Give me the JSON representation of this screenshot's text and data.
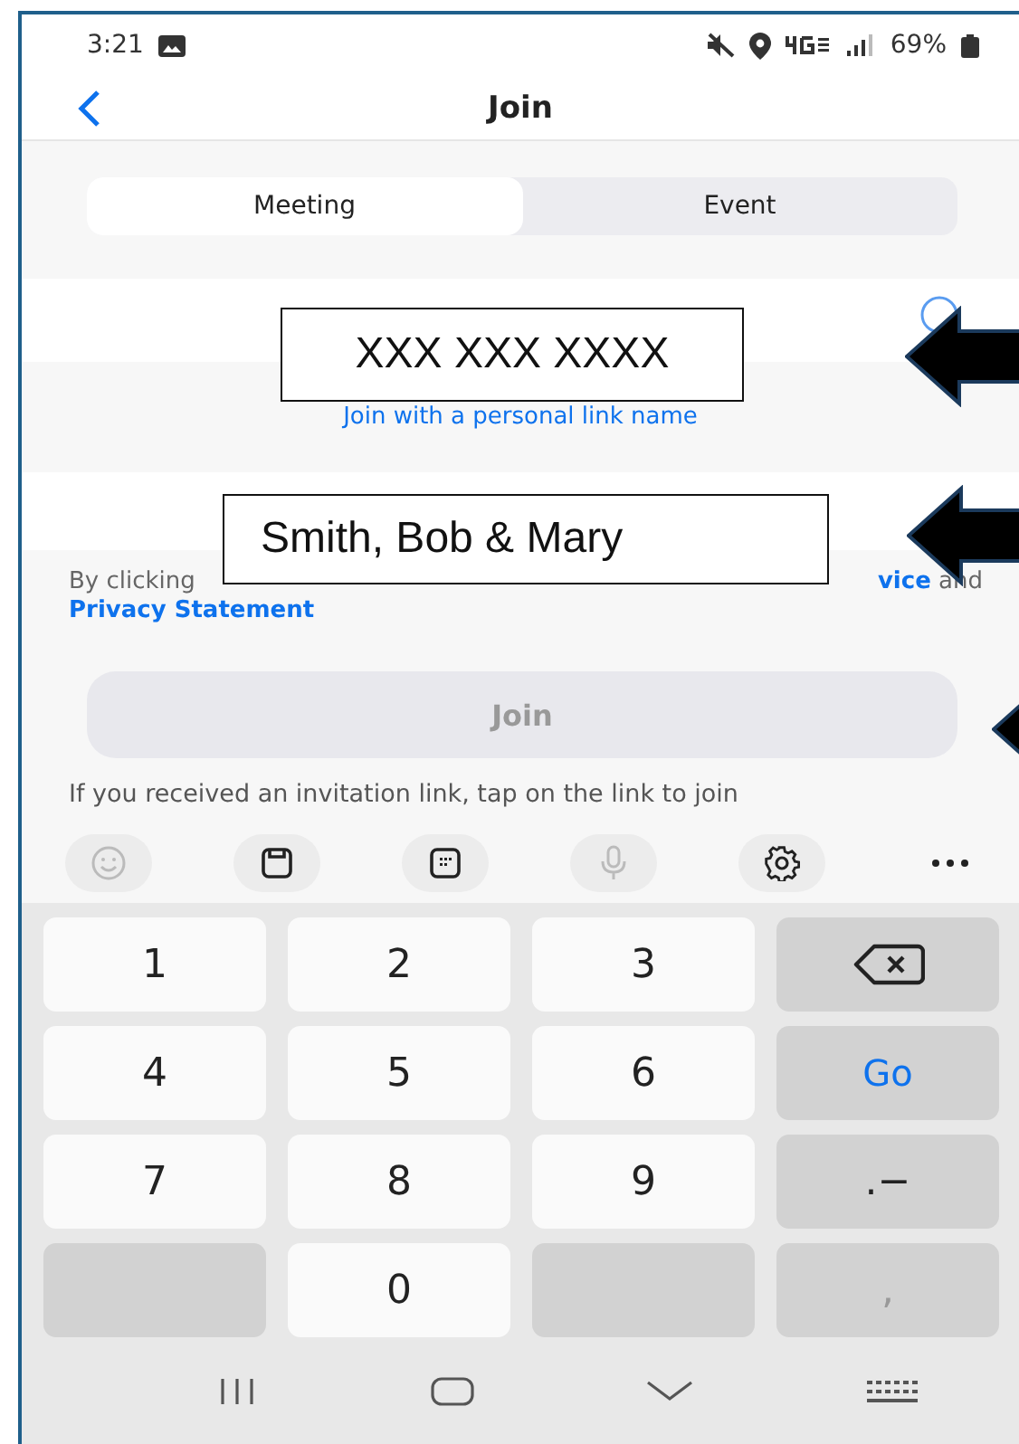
{
  "status_bar": {
    "time": "3:21",
    "battery": "69%"
  },
  "header": {
    "title": "Join"
  },
  "tabs": [
    {
      "label": "Meeting",
      "selected": true
    },
    {
      "label": "Event",
      "selected": false
    }
  ],
  "personal_link": "Join with a personal link name",
  "disclaimer": {
    "lead": "By clicking",
    "link_tail": "vice",
    "tail": "and",
    "link": "Privacy Statement"
  },
  "join_button": {
    "label": "Join",
    "disabled": true
  },
  "hint": "If you received an invitation link, tap on the link to join",
  "keyboard_toolbar": [
    {
      "kind": "emoji",
      "disabled": true
    },
    {
      "kind": "clipboard",
      "disabled": false
    },
    {
      "kind": "keypad",
      "disabled": false
    },
    {
      "kind": "mic",
      "disabled": true
    },
    {
      "kind": "settings",
      "disabled": false
    },
    {
      "kind": "more",
      "disabled": false
    }
  ],
  "keys": [
    {
      "kind": "char",
      "label": "1"
    },
    {
      "kind": "char",
      "label": "2"
    },
    {
      "kind": "char",
      "label": "3"
    },
    {
      "kind": "backspace"
    },
    {
      "kind": "char",
      "label": "4"
    },
    {
      "kind": "char",
      "label": "5"
    },
    {
      "kind": "char",
      "label": "6"
    },
    {
      "kind": "action",
      "label": "Go"
    },
    {
      "kind": "char",
      "label": "7"
    },
    {
      "kind": "char",
      "label": "8"
    },
    {
      "kind": "char",
      "label": "9"
    },
    {
      "kind": "symbol",
      "label": ".−"
    },
    {
      "kind": "blank"
    },
    {
      "kind": "char",
      "label": "0"
    },
    {
      "kind": "blank"
    },
    {
      "kind": "faint",
      "label": ","
    }
  ],
  "callouts": {
    "meeting_id": "XXX XXX XXXX",
    "name": "Smith, Bob & Mary"
  }
}
